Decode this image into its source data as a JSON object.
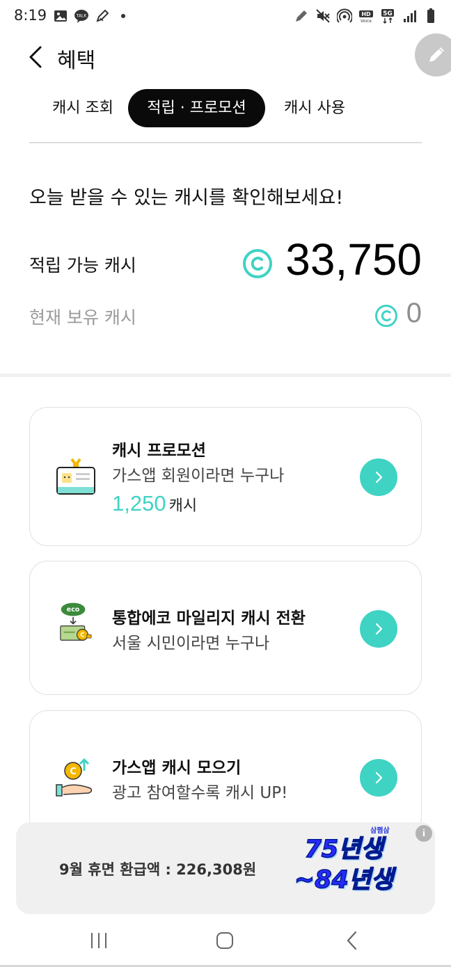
{
  "status_bar": {
    "time": "8:19",
    "left_icons": [
      "gallery-icon",
      "kakaotalk-icon",
      "pencil-icon",
      "dot-icon"
    ],
    "right_icons": [
      "pen-icon",
      "mute-icon",
      "hotspot-icon",
      "hd-voice-icon",
      "5g-icon",
      "signal-icon",
      "battery-icon"
    ]
  },
  "header": {
    "title": "혜택"
  },
  "tabs": [
    {
      "label": "캐시 조회",
      "active": false
    },
    {
      "label": "적립 · 프로모션",
      "active": true
    },
    {
      "label": "캐시 사용",
      "active": false
    }
  ],
  "summary": {
    "intro": "오늘 받을 수 있는 캐시를 확인해보세요!",
    "earnable_label": "적립 가능 캐시",
    "earnable_amount": "33,750",
    "owned_label": "현재 보유 캐시",
    "owned_amount": "0"
  },
  "cards": [
    {
      "title": "캐시 프로모션",
      "subtitle": "가스앱 회원이라면 누구나",
      "amount": "1,250",
      "unit": "캐시",
      "icon": "id-card-icon"
    },
    {
      "title": "통합에코 마일리지 캐시 전환",
      "subtitle": "서울 시민이라면 누구나",
      "icon": "eco-exchange-icon",
      "icon_text": "eco"
    },
    {
      "title": "가스앱 캐시 모으기",
      "subtitle": "광고 참여할수록 캐시 UP!",
      "icon": "coin-hand-icon"
    }
  ],
  "ad": {
    "text": "9월 휴면 환급액 : 226,308원",
    "brand": "삼쩜삼",
    "slogan_line1": "75년생",
    "slogan_line2": "~84년생",
    "info": "i"
  },
  "colors": {
    "accent": "#3fd3c4",
    "active_tab_bg": "#0a0a0a",
    "ad_slogan": "#2a2aff"
  }
}
